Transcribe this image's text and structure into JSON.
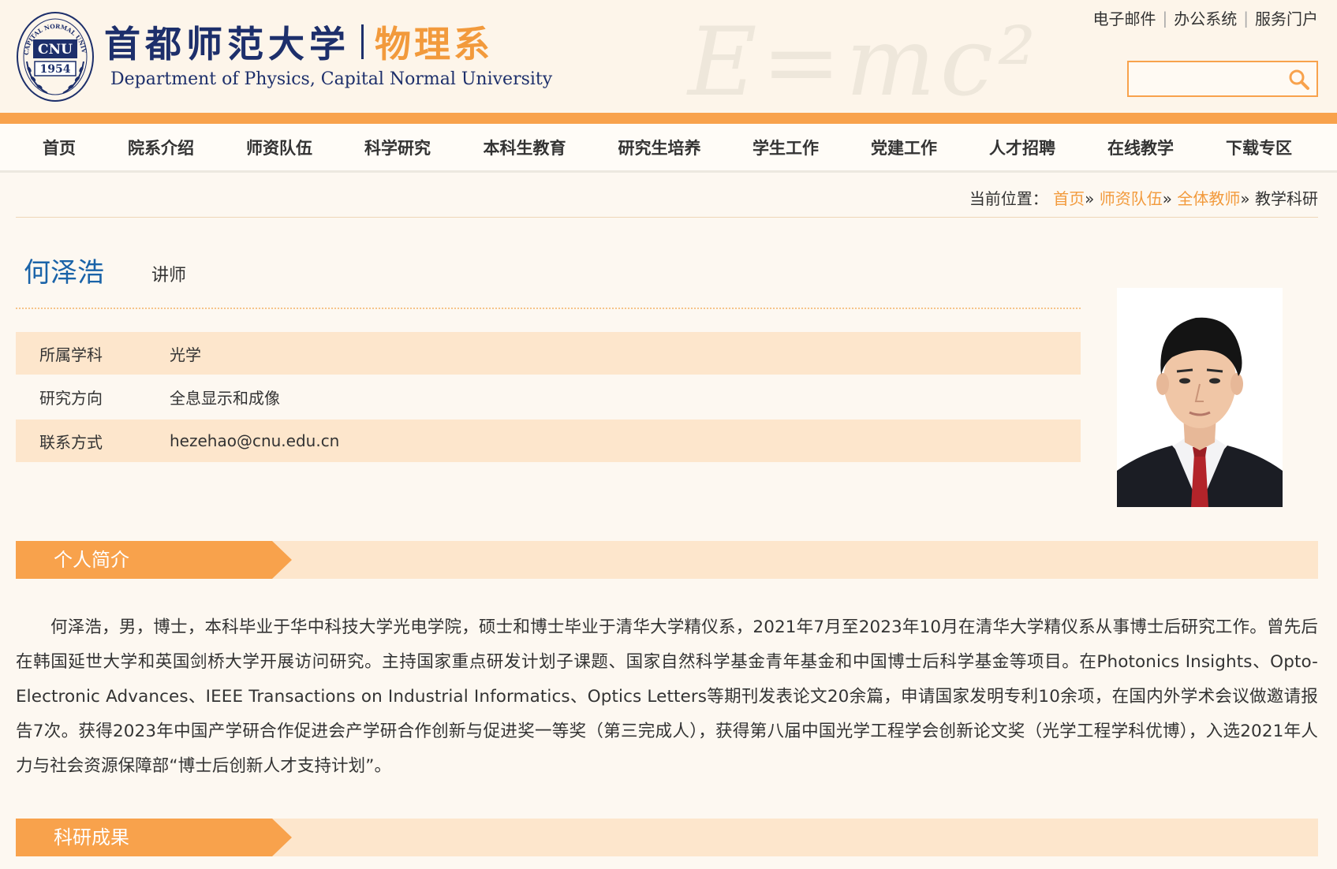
{
  "header": {
    "seal_text": {
      "abbr": "CNU",
      "year": "1954",
      "ring_top": "CAPITAL NORMAL UNIVERSITY"
    },
    "school_name_cn": "首都师范大学",
    "dept_name_cn": "物理系",
    "dept_name_en": "Department of Physics, Capital Normal University",
    "watermark": "E=mc²",
    "top_links": [
      "电子邮件",
      "办公系统",
      "服务门户"
    ],
    "search": {
      "placeholder": "",
      "value": ""
    },
    "accent_color": "#f8a24c",
    "brand_navy": "#1d2f6b"
  },
  "nav": {
    "items": [
      "首页",
      "院系介绍",
      "师资队伍",
      "科学研究",
      "本科生教育",
      "研究生培养",
      "学生工作",
      "党建工作",
      "人才招聘",
      "在线教学",
      "下载专区"
    ]
  },
  "breadcrumb": {
    "prefix": "当前位置：",
    "links": [
      "首页",
      "师资队伍",
      "全体教师"
    ],
    "separator": "»",
    "current": "教学科研"
  },
  "profile": {
    "name": "何泽浩",
    "title": "讲师",
    "info": [
      {
        "label": "所属学科",
        "value": "光学"
      },
      {
        "label": "研究方向",
        "value": "全息显示和成像"
      },
      {
        "label": "联系方式",
        "value": "hezehao@cnu.edu.cn"
      }
    ]
  },
  "sections": {
    "bio_title": "个人简介",
    "bio_text": "何泽浩，男，博士，本科毕业于华中科技大学光电学院，硕士和博士毕业于清华大学精仪系，2021年7月至2023年10月在清华大学精仪系从事博士后研究工作。曾先后在韩国延世大学和英国剑桥大学开展访问研究。主持国家重点研发计划子课题、国家自然科学基金青年基金和中国博士后科学基金等项目。在Photonics Insights、Opto-Electronic Advances、IEEE Transactions on Industrial Informatics、Optics Letters等期刊发表论文20余篇，申请国家发明专利10余项，在国内外学术会议做邀请报告7次。获得2023年中国产学研合作促进会产学研合作创新与促进奖一等奖（第三完成人），获得第八届中国光学工程学会创新论文奖（光学工程学科优博），入选2021年人力与社会资源保障部“博士后创新人才支持计划”。",
    "research_title": "科研成果"
  }
}
